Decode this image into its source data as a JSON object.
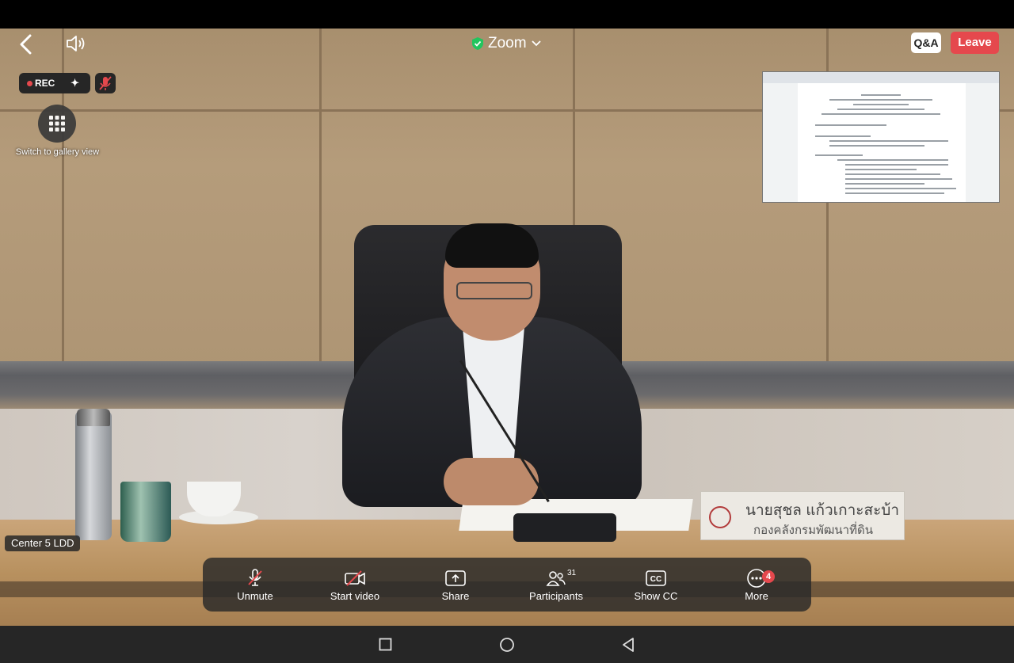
{
  "app": {
    "title": "Zoom",
    "qa_label": "Q&A",
    "leave_label": "Leave",
    "rec_label": "REC",
    "gallery_label": "Switch to gallery view",
    "participant_name": "Center 5 LDD"
  },
  "nameplate": {
    "name": "นายสุชล  แก้วเกาะสะบ้า",
    "org": "กองคลังกรมพัฒนาที่ดิน"
  },
  "toolbar": {
    "items": [
      {
        "label": "Unmute",
        "icon": "mic-muted-icon"
      },
      {
        "label": "Start video",
        "icon": "video-off-icon"
      },
      {
        "label": "Share",
        "icon": "share-icon"
      },
      {
        "label": "Participants",
        "icon": "participants-icon",
        "count": "31"
      },
      {
        "label": "Show CC",
        "icon": "cc-icon"
      },
      {
        "label": "More",
        "icon": "more-icon",
        "badge": "4"
      }
    ]
  },
  "colors": {
    "leave": "#e5484d",
    "rec_dot": "#e5484d",
    "shield": "#22c55e"
  }
}
